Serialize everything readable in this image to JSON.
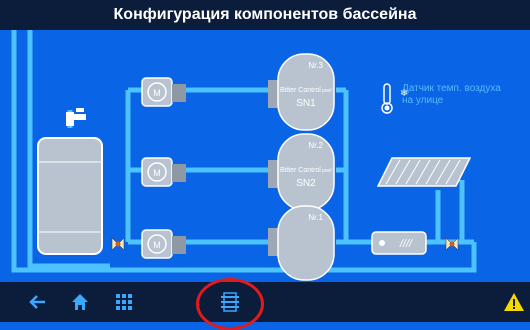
{
  "header": {
    "title": "Конфигурация компонентов бассейна"
  },
  "filters": [
    {
      "number": "Nr.3",
      "brand": "Bitter Control",
      "brand_suffix": "pool",
      "model": "SN1"
    },
    {
      "number": "Nr.2",
      "brand": "Bitter Control",
      "brand_suffix": "pool",
      "model": "SN2"
    },
    {
      "number": "Nr.1",
      "brand": "",
      "brand_suffix": "",
      "model": ""
    }
  ],
  "sensor": {
    "line1": "Датчик темп. воздуха",
    "line2": "на улице"
  },
  "pumps": [
    {
      "letter": "M"
    },
    {
      "letter": "M"
    },
    {
      "letter": "M"
    }
  ],
  "heater": {
    "label": "////"
  },
  "toolbar": {
    "buttons": [
      "back-arrow-icon",
      "home-icon",
      "grid-menu-icon",
      "component-config-icon"
    ],
    "warning": "warning-icon"
  },
  "colors": {
    "pipe": "#4cc3ff",
    "background": "#0a64e6",
    "bar": "#0b1d3a",
    "highlight": "#e11b1b",
    "warning": "#f5d800"
  }
}
